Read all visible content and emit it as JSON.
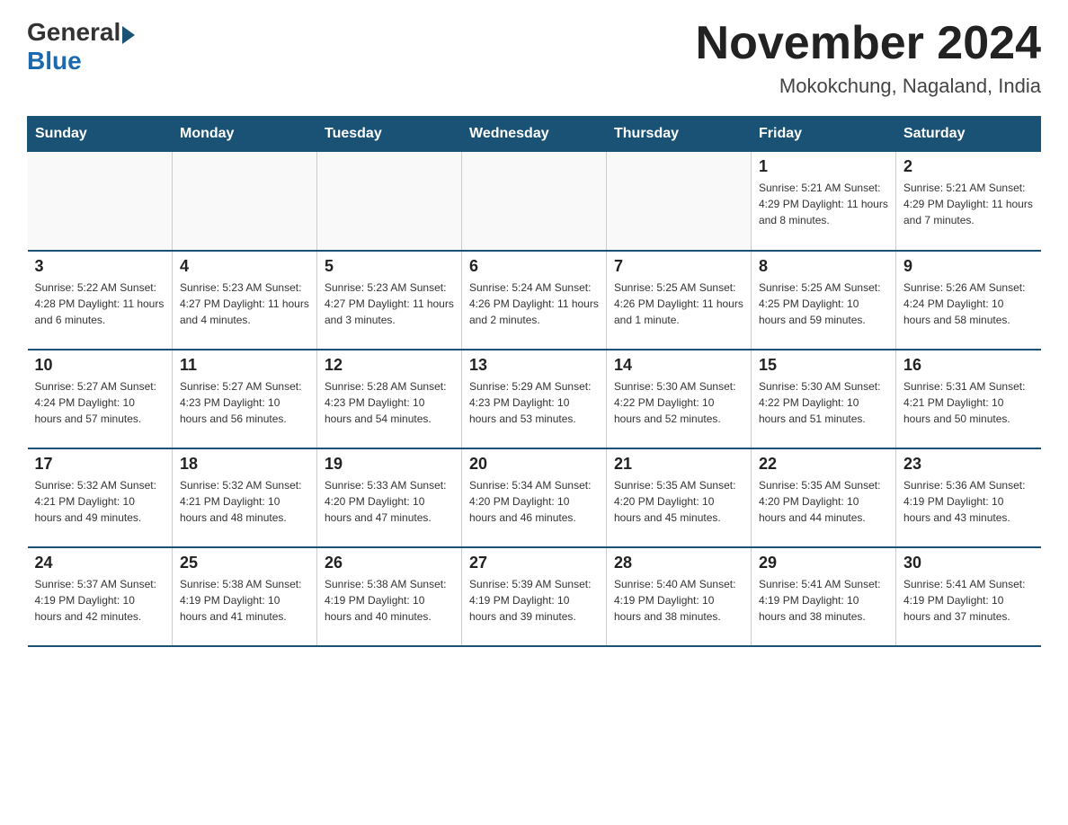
{
  "header": {
    "logo_general": "General",
    "logo_blue": "Blue",
    "month_title": "November 2024",
    "location": "Mokokchung, Nagaland, India"
  },
  "weekdays": [
    "Sunday",
    "Monday",
    "Tuesday",
    "Wednesday",
    "Thursday",
    "Friday",
    "Saturday"
  ],
  "weeks": [
    [
      {
        "day": "",
        "info": ""
      },
      {
        "day": "",
        "info": ""
      },
      {
        "day": "",
        "info": ""
      },
      {
        "day": "",
        "info": ""
      },
      {
        "day": "",
        "info": ""
      },
      {
        "day": "1",
        "info": "Sunrise: 5:21 AM\nSunset: 4:29 PM\nDaylight: 11 hours and 8 minutes."
      },
      {
        "day": "2",
        "info": "Sunrise: 5:21 AM\nSunset: 4:29 PM\nDaylight: 11 hours and 7 minutes."
      }
    ],
    [
      {
        "day": "3",
        "info": "Sunrise: 5:22 AM\nSunset: 4:28 PM\nDaylight: 11 hours and 6 minutes."
      },
      {
        "day": "4",
        "info": "Sunrise: 5:23 AM\nSunset: 4:27 PM\nDaylight: 11 hours and 4 minutes."
      },
      {
        "day": "5",
        "info": "Sunrise: 5:23 AM\nSunset: 4:27 PM\nDaylight: 11 hours and 3 minutes."
      },
      {
        "day": "6",
        "info": "Sunrise: 5:24 AM\nSunset: 4:26 PM\nDaylight: 11 hours and 2 minutes."
      },
      {
        "day": "7",
        "info": "Sunrise: 5:25 AM\nSunset: 4:26 PM\nDaylight: 11 hours and 1 minute."
      },
      {
        "day": "8",
        "info": "Sunrise: 5:25 AM\nSunset: 4:25 PM\nDaylight: 10 hours and 59 minutes."
      },
      {
        "day": "9",
        "info": "Sunrise: 5:26 AM\nSunset: 4:24 PM\nDaylight: 10 hours and 58 minutes."
      }
    ],
    [
      {
        "day": "10",
        "info": "Sunrise: 5:27 AM\nSunset: 4:24 PM\nDaylight: 10 hours and 57 minutes."
      },
      {
        "day": "11",
        "info": "Sunrise: 5:27 AM\nSunset: 4:23 PM\nDaylight: 10 hours and 56 minutes."
      },
      {
        "day": "12",
        "info": "Sunrise: 5:28 AM\nSunset: 4:23 PM\nDaylight: 10 hours and 54 minutes."
      },
      {
        "day": "13",
        "info": "Sunrise: 5:29 AM\nSunset: 4:23 PM\nDaylight: 10 hours and 53 minutes."
      },
      {
        "day": "14",
        "info": "Sunrise: 5:30 AM\nSunset: 4:22 PM\nDaylight: 10 hours and 52 minutes."
      },
      {
        "day": "15",
        "info": "Sunrise: 5:30 AM\nSunset: 4:22 PM\nDaylight: 10 hours and 51 minutes."
      },
      {
        "day": "16",
        "info": "Sunrise: 5:31 AM\nSunset: 4:21 PM\nDaylight: 10 hours and 50 minutes."
      }
    ],
    [
      {
        "day": "17",
        "info": "Sunrise: 5:32 AM\nSunset: 4:21 PM\nDaylight: 10 hours and 49 minutes."
      },
      {
        "day": "18",
        "info": "Sunrise: 5:32 AM\nSunset: 4:21 PM\nDaylight: 10 hours and 48 minutes."
      },
      {
        "day": "19",
        "info": "Sunrise: 5:33 AM\nSunset: 4:20 PM\nDaylight: 10 hours and 47 minutes."
      },
      {
        "day": "20",
        "info": "Sunrise: 5:34 AM\nSunset: 4:20 PM\nDaylight: 10 hours and 46 minutes."
      },
      {
        "day": "21",
        "info": "Sunrise: 5:35 AM\nSunset: 4:20 PM\nDaylight: 10 hours and 45 minutes."
      },
      {
        "day": "22",
        "info": "Sunrise: 5:35 AM\nSunset: 4:20 PM\nDaylight: 10 hours and 44 minutes."
      },
      {
        "day": "23",
        "info": "Sunrise: 5:36 AM\nSunset: 4:19 PM\nDaylight: 10 hours and 43 minutes."
      }
    ],
    [
      {
        "day": "24",
        "info": "Sunrise: 5:37 AM\nSunset: 4:19 PM\nDaylight: 10 hours and 42 minutes."
      },
      {
        "day": "25",
        "info": "Sunrise: 5:38 AM\nSunset: 4:19 PM\nDaylight: 10 hours and 41 minutes."
      },
      {
        "day": "26",
        "info": "Sunrise: 5:38 AM\nSunset: 4:19 PM\nDaylight: 10 hours and 40 minutes."
      },
      {
        "day": "27",
        "info": "Sunrise: 5:39 AM\nSunset: 4:19 PM\nDaylight: 10 hours and 39 minutes."
      },
      {
        "day": "28",
        "info": "Sunrise: 5:40 AM\nSunset: 4:19 PM\nDaylight: 10 hours and 38 minutes."
      },
      {
        "day": "29",
        "info": "Sunrise: 5:41 AM\nSunset: 4:19 PM\nDaylight: 10 hours and 38 minutes."
      },
      {
        "day": "30",
        "info": "Sunrise: 5:41 AM\nSunset: 4:19 PM\nDaylight: 10 hours and 37 minutes."
      }
    ]
  ]
}
